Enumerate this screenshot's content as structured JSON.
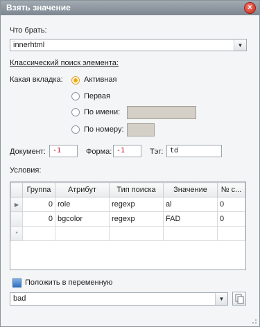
{
  "window": {
    "title": "Взять значение",
    "close_glyph": "×"
  },
  "take_label": "Что брать:",
  "take_combo": {
    "value": "innerhtml"
  },
  "classic_search_link": "Классический поиск элемента:",
  "tab_label": "Какая вкладка:",
  "radios": [
    {
      "label": "Активная",
      "selected": true
    },
    {
      "label": "Первая",
      "selected": false
    },
    {
      "label": "По имени:",
      "selected": false
    },
    {
      "label": "По номеру:",
      "selected": false
    }
  ],
  "document_label": "Документ:",
  "document_value": "-1",
  "form_label": "Форма:",
  "form_value": "-1",
  "tag_label": "Тэг:",
  "tag_value": "td",
  "conditions_label": "Условия:",
  "grid": {
    "columns": [
      "Группа",
      "Атрибут",
      "Тип поиска",
      "Значение",
      "№ с..."
    ],
    "rows": [
      [
        "0",
        "role",
        "regexp",
        "al",
        "0"
      ],
      [
        "0",
        "bgcolor",
        "regexp",
        "FAD",
        "0"
      ]
    ],
    "new_row_marker": "*"
  },
  "save_to_var_label": "Положить в переменную",
  "var_combo": {
    "value": "bad"
  }
}
